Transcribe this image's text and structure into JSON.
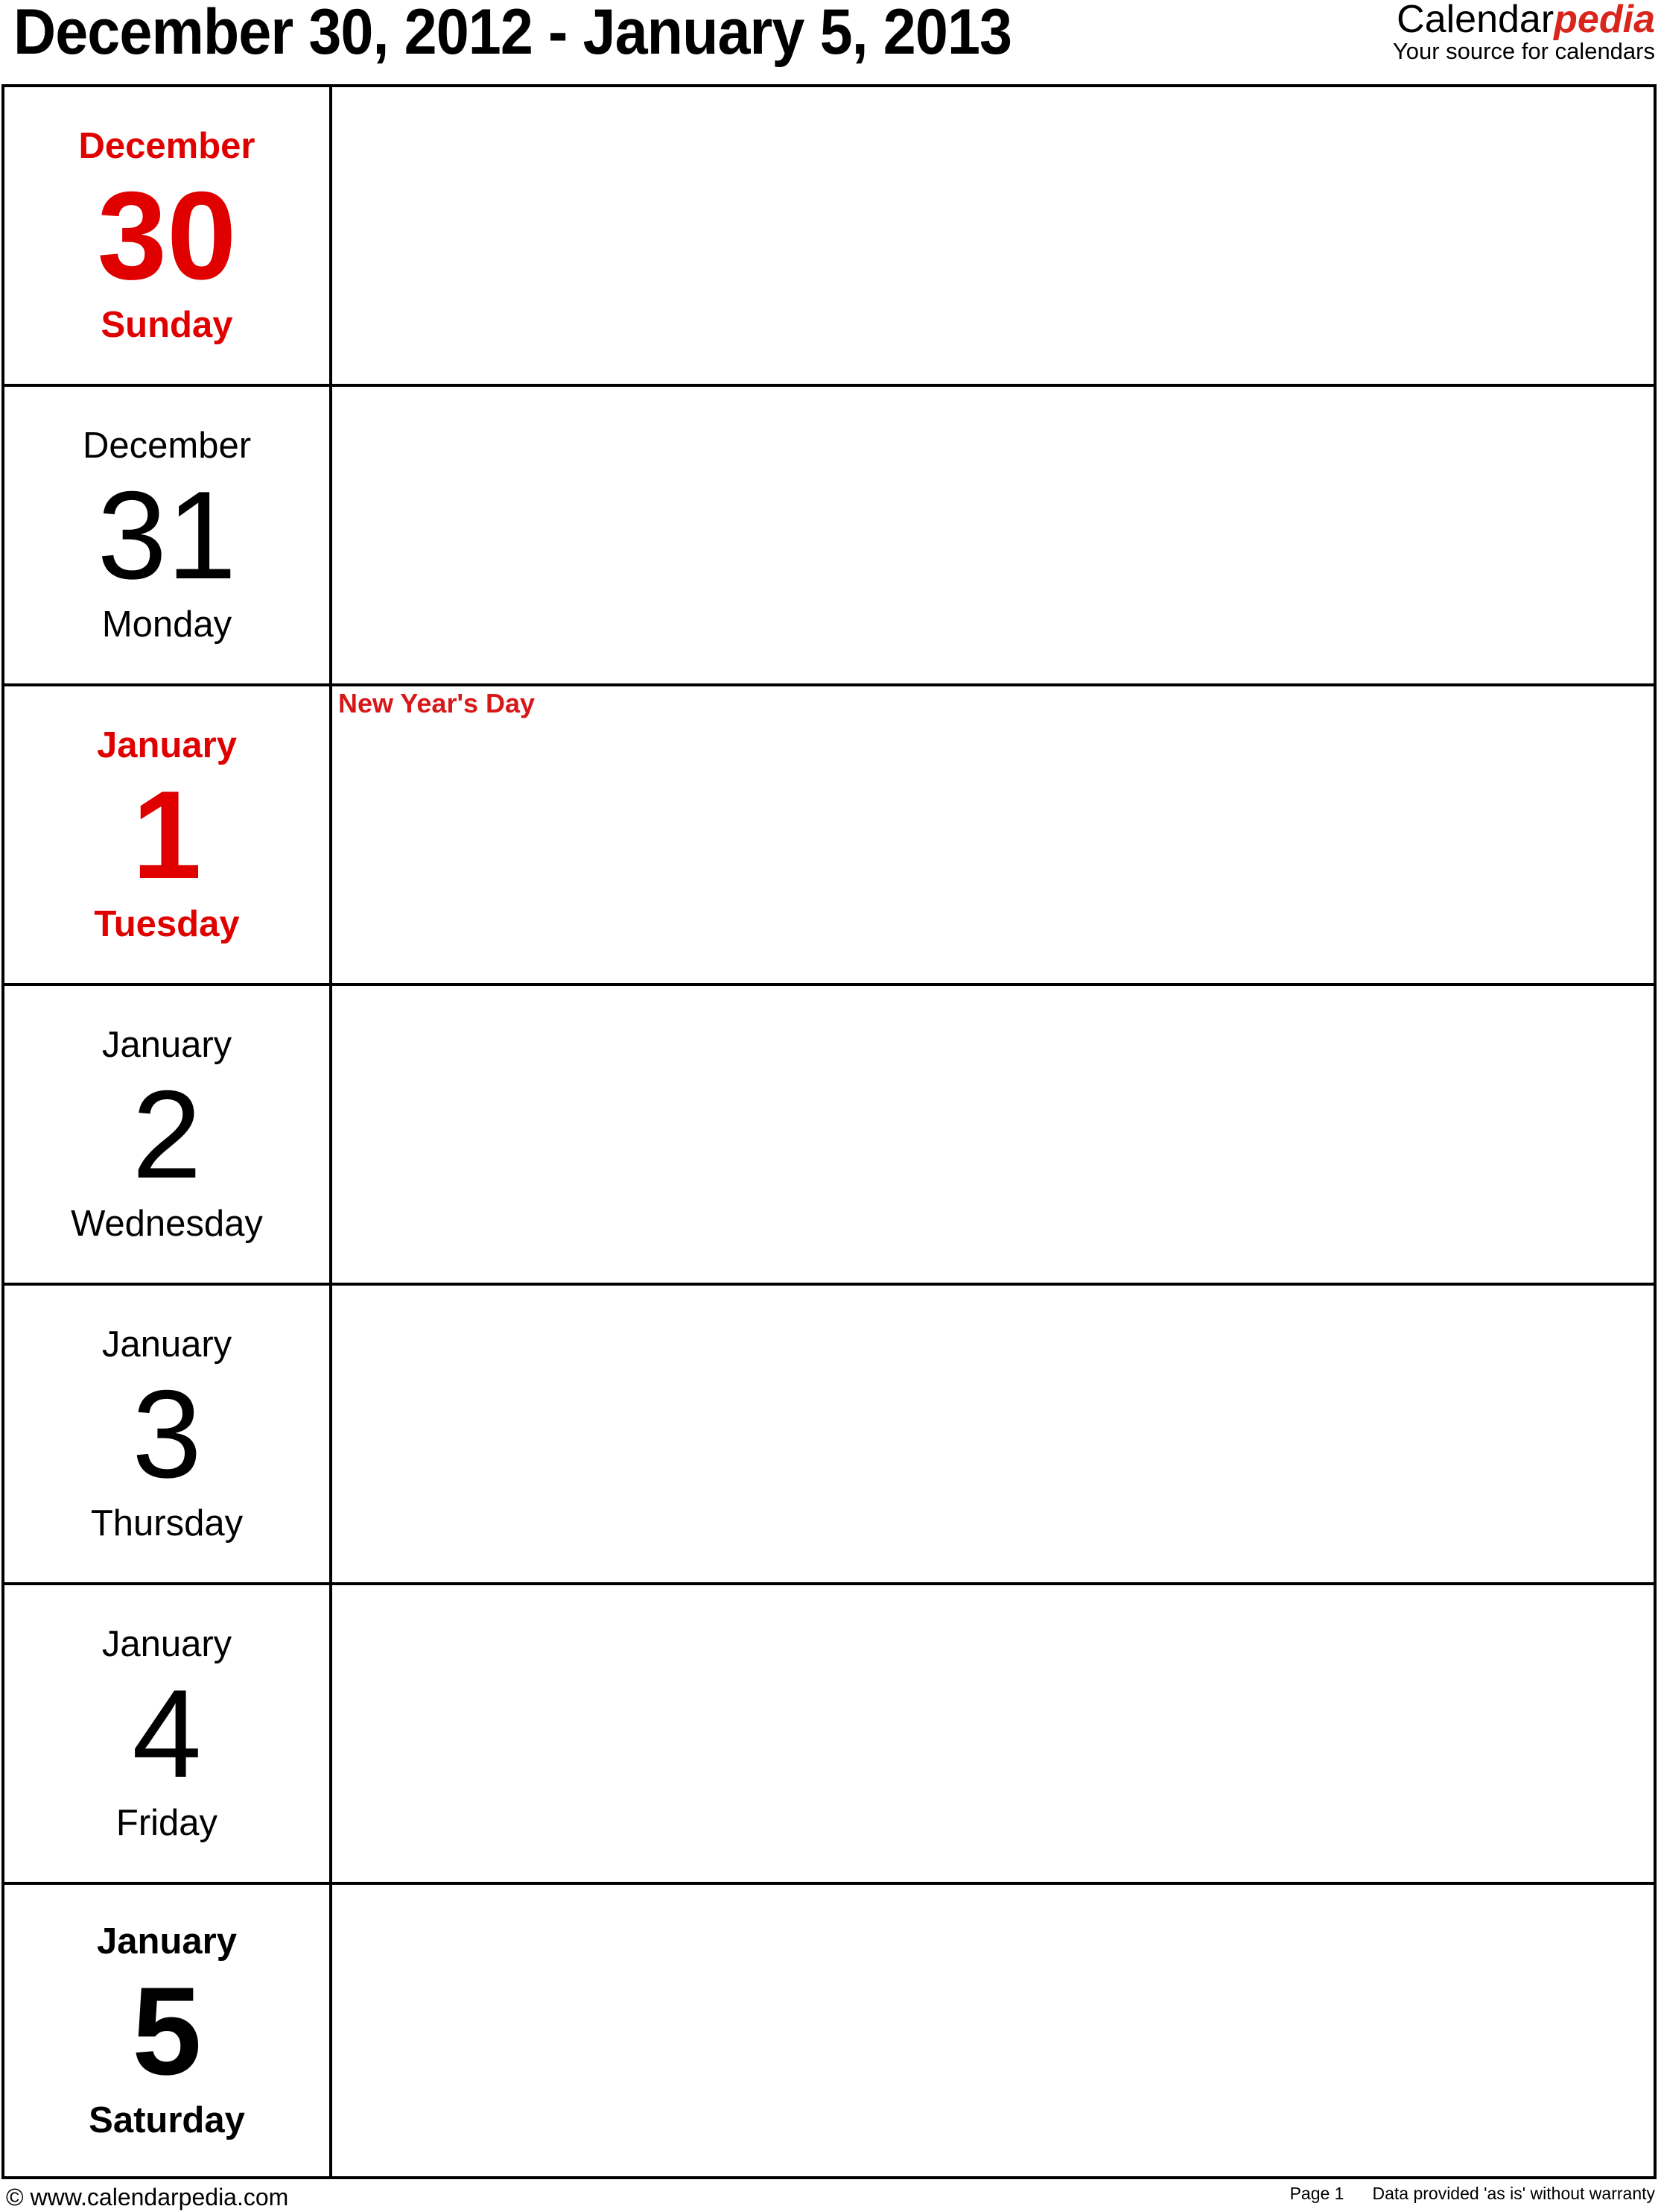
{
  "header": {
    "title": "December 30, 2012 - January 5, 2013",
    "logo_main": "Calendar",
    "logo_accent": "pedia",
    "logo_tagline": "Your source for calendars"
  },
  "colors": {
    "holiday_red": "#e00000",
    "logo_red": "#d9261c",
    "text": "#000000"
  },
  "days": [
    {
      "month": "December",
      "day": "30",
      "weekday": "Sunday",
      "style": "red-bold",
      "event": ""
    },
    {
      "month": "December",
      "day": "31",
      "weekday": "Monday",
      "style": "regular",
      "event": ""
    },
    {
      "month": "January",
      "day": "1",
      "weekday": "Tuesday",
      "style": "red-bold",
      "event": "New Year's Day"
    },
    {
      "month": "January",
      "day": "2",
      "weekday": "Wednesday",
      "style": "regular",
      "event": ""
    },
    {
      "month": "January",
      "day": "3",
      "weekday": "Thursday",
      "style": "regular",
      "event": ""
    },
    {
      "month": "January",
      "day": "4",
      "weekday": "Friday",
      "style": "regular",
      "event": ""
    },
    {
      "month": "January",
      "day": "5",
      "weekday": "Saturday",
      "style": "bold",
      "event": ""
    }
  ],
  "footer": {
    "copyright": "© www.calendarpedia.com",
    "page": "Page 1",
    "disclaimer": "Data provided 'as is' without warranty"
  }
}
